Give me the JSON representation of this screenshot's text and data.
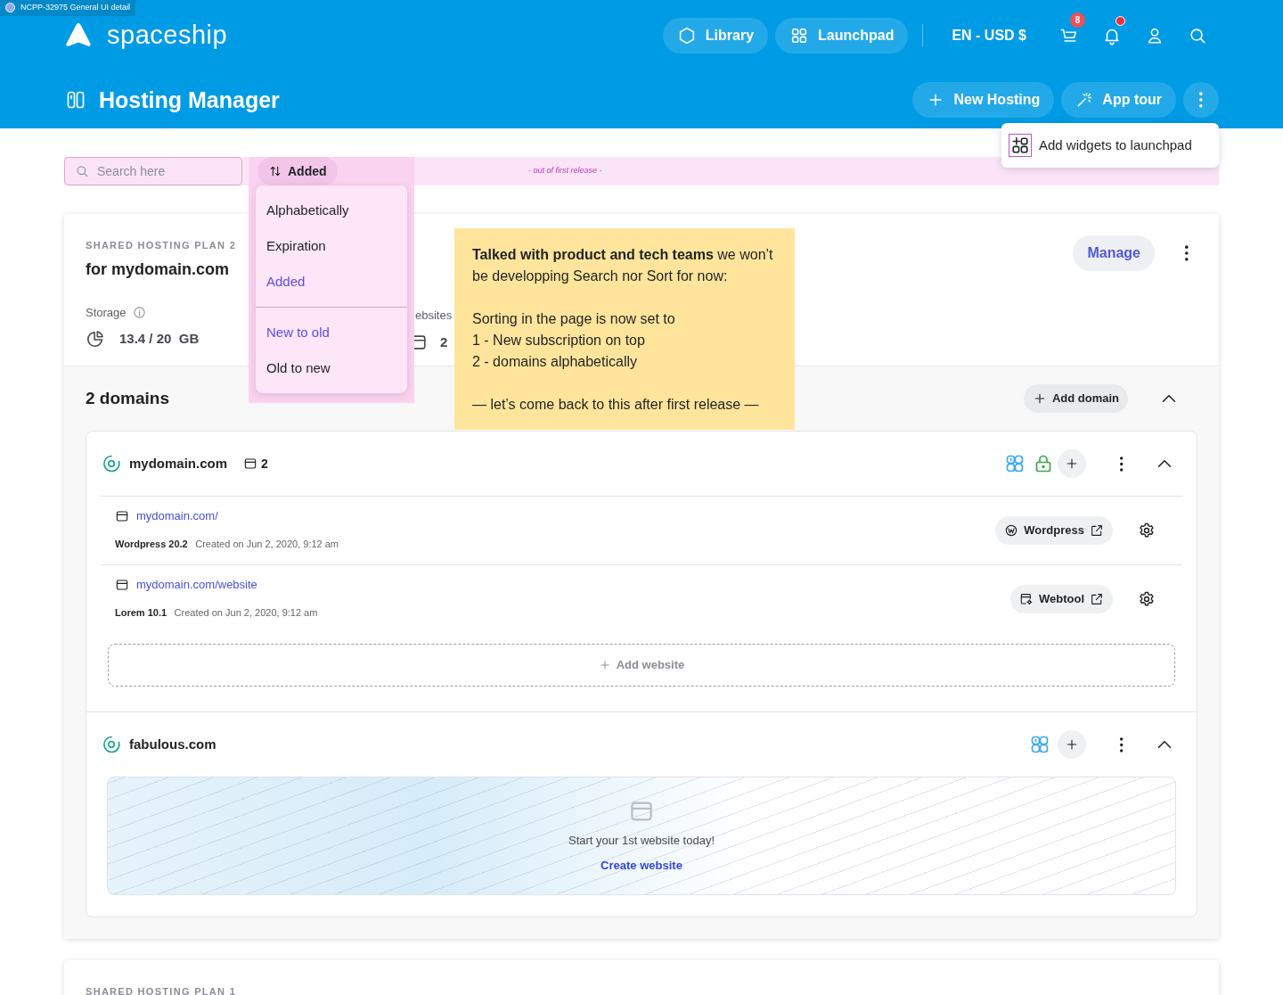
{
  "tag": {
    "label": "NCPP-32975 General UI detail"
  },
  "header": {
    "brand": "spaceship",
    "nav": [
      {
        "label": "Library"
      },
      {
        "label": "Launchpad"
      }
    ],
    "locale": "EN - USD $",
    "cart_badge": "8",
    "notifications_unread": true
  },
  "page": {
    "title": "Hosting Manager",
    "actions": [
      {
        "label": "New Hosting"
      },
      {
        "label": "App tour"
      }
    ],
    "menu": {
      "open": true,
      "items": [
        "Add widgets to launchpad"
      ]
    }
  },
  "toolbar": {
    "search": {
      "placeholder": "Search here"
    },
    "sort": {
      "label": "Added",
      "open": true
    },
    "note": "- out of first release -",
    "sort_options": [
      {
        "label": "Alphabetically",
        "selected": false
      },
      {
        "label": "Expiration",
        "selected": false
      },
      {
        "label": "Added",
        "selected": true
      }
    ],
    "order_options": [
      {
        "label": "New to old",
        "selected": true
      },
      {
        "label": "Old to new",
        "selected": false
      }
    ]
  },
  "sticky_note": {
    "paragraphs": [
      [
        "**Talked with product and tech teams** we won’t be developping Search nor Sort for now:"
      ],
      [
        "Sorting in the page is now set to",
        "1 - New subscription on top",
        "2 - domains alphabetically"
      ],
      [
        "— let’s come back to this after first release —"
      ]
    ]
  },
  "plans": [
    {
      "type": "SHARED HOSTING PLAN 2",
      "title": "for mydomain.com",
      "storage_label": "Storage",
      "storage_value": "13.4 / 20  GB",
      "websites_label": "ebsites",
      "websites_count": "2",
      "manage": "Manage",
      "domains_title": "2 domains",
      "add_domain": "Add domain",
      "expanded": true,
      "domains": [
        {
          "name": "mydomain.com",
          "website_count": "2",
          "ssl": true,
          "expanded": true,
          "websites": [
            {
              "url": "mydomain.com/",
              "app": "Wordpress 20.2",
              "created": "Created on Jun 2, 2020, 9:12 am",
              "tool": "Wordpress",
              "kind": "wordpress"
            },
            {
              "url": "mydomain.com/website",
              "app": "Lorem 10.1",
              "created": "Created on Jun 2, 2020, 9:12 am",
              "tool": "Webtool",
              "kind": "webtool"
            }
          ],
          "add_website": "Add website"
        },
        {
          "name": "fabulous.com",
          "ssl": false,
          "expanded": true,
          "empty": {
            "message": "Start your 1st website today!",
            "action": "Create website"
          }
        }
      ]
    },
    {
      "type": "SHARED HOSTING PLAN 1"
    }
  ]
}
